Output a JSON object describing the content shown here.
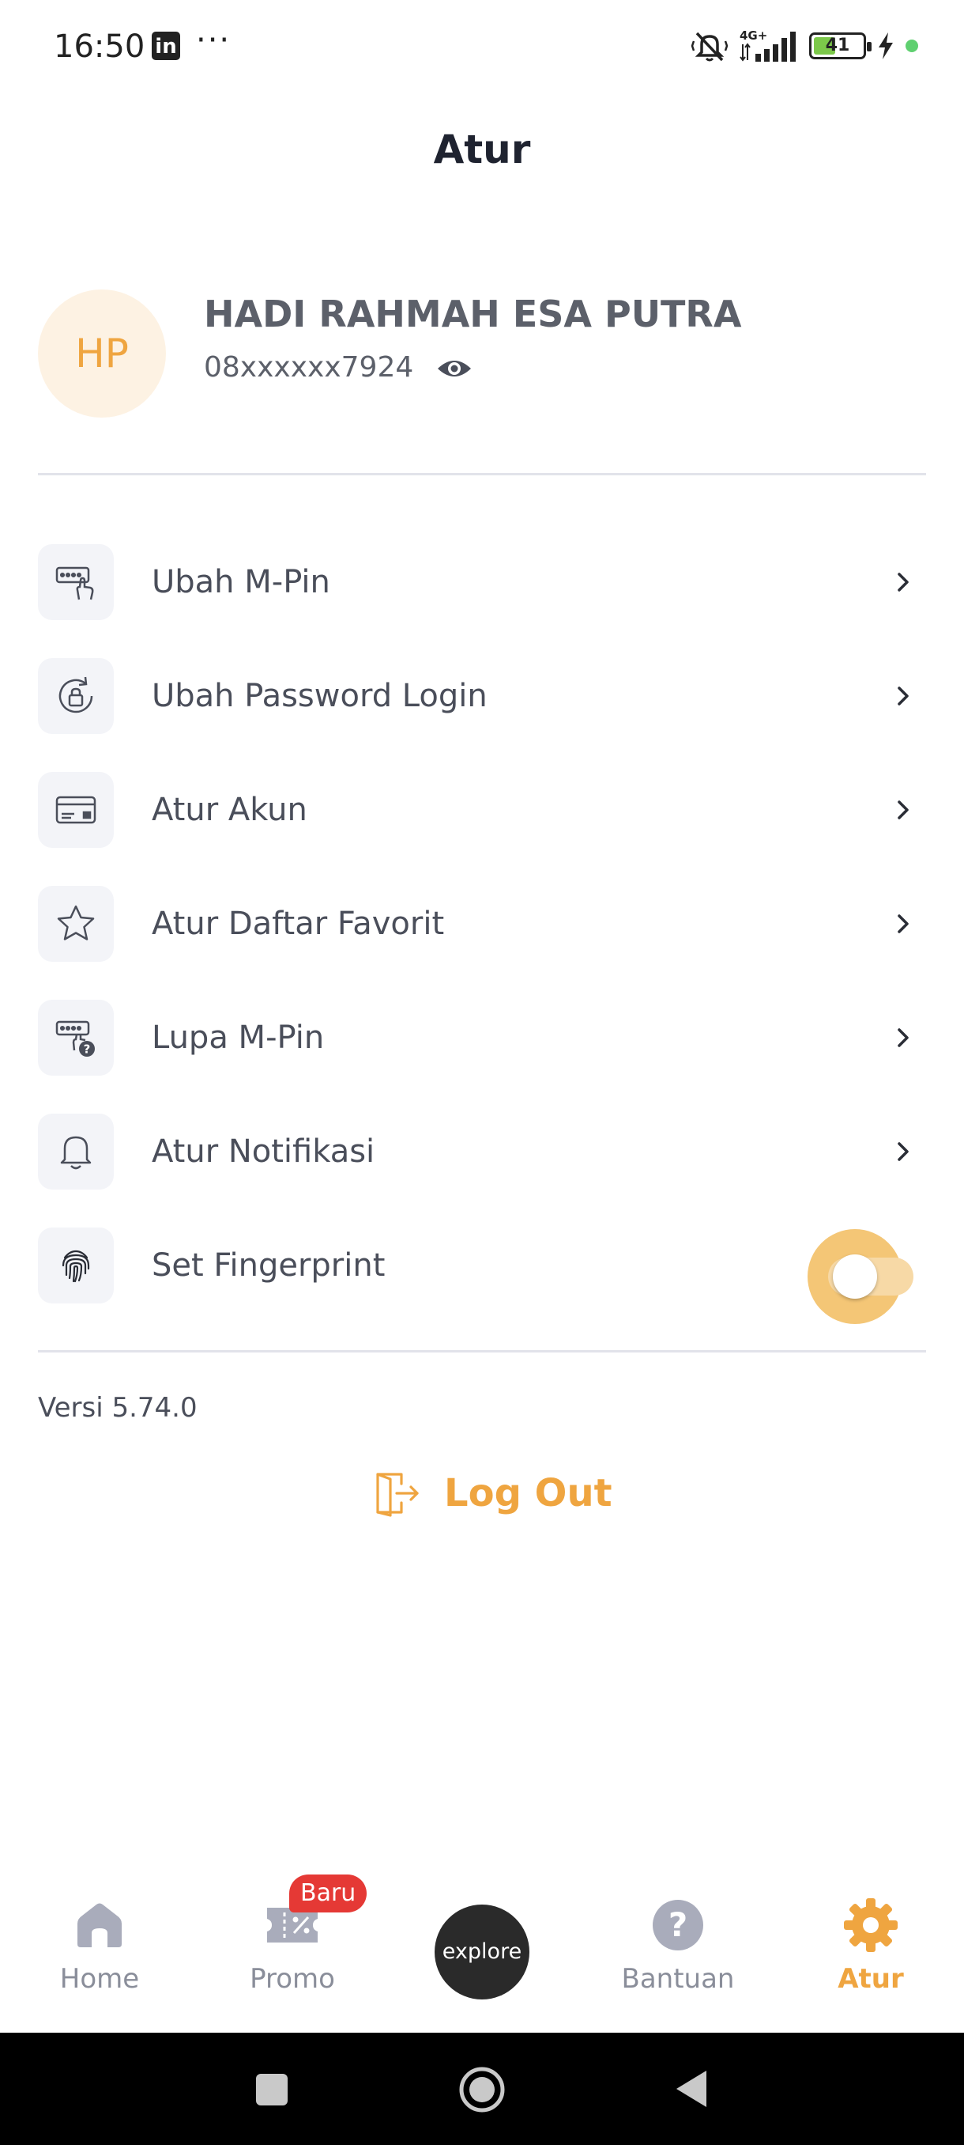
{
  "status_bar": {
    "time": "16:50",
    "app_icon": "in",
    "more": "···",
    "network": "4G+",
    "battery": "41"
  },
  "header": {
    "title": "Atur"
  },
  "profile": {
    "initials": "HP",
    "name": "HADI RAHMAH ESA PUTRA",
    "phone": "08xxxxxx7924"
  },
  "menu": [
    {
      "label": "Ubah M-Pin",
      "icon": "keypad-hand-icon"
    },
    {
      "label": "Ubah Password Login",
      "icon": "lock-reset-icon"
    },
    {
      "label": "Atur Akun",
      "icon": "card-icon"
    },
    {
      "label": "Atur Daftar Favorit",
      "icon": "star-icon"
    },
    {
      "label": "Lupa M-Pin",
      "icon": "keypad-question-icon"
    },
    {
      "label": "Atur Notifikasi",
      "icon": "bell-icon"
    },
    {
      "label": "Set Fingerprint",
      "icon": "fingerprint-icon"
    }
  ],
  "fingerprint_enabled": false,
  "version": "Versi 5.74.0",
  "logout_label": "Log Out",
  "bottom_nav": {
    "home": "Home",
    "promo": "Promo",
    "promo_badge": "Baru",
    "explore": "explore",
    "help": "Bantuan",
    "settings": "Atur",
    "active": "settings"
  },
  "colors": {
    "accent": "#efa540",
    "badge": "#e53935",
    "icon_grey": "#a9acbb"
  }
}
